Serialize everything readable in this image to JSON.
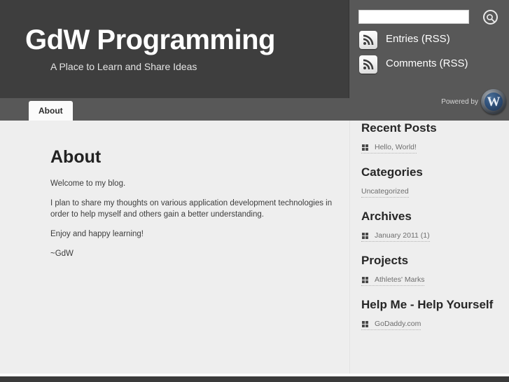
{
  "site": {
    "title": "GdW Programming",
    "tagline": "A Place to Learn and Share Ideas"
  },
  "search": {
    "value": "",
    "placeholder": "",
    "button_icon": "search-icon"
  },
  "feeds": [
    {
      "label": "Entries (RSS)",
      "icon": "rss-icon"
    },
    {
      "label": "Comments (RSS)",
      "icon": "rss-icon"
    }
  ],
  "powered_by": {
    "text": "Powered by",
    "logo_letter": "W",
    "logo_name": "wordpress-logo"
  },
  "nav": {
    "items": [
      {
        "label": "About",
        "active": true
      }
    ]
  },
  "main": {
    "title": "About",
    "paragraphs": [
      "Welcome to my blog.",
      "I plan to share my thoughts on various application development technologies in order to help myself and others gain a better understanding.",
      "Enjoy and happy learning!",
      "~GdW"
    ]
  },
  "sidebar": {
    "widgets": [
      {
        "title": "Recent Posts",
        "items": [
          {
            "label": "Hello, World!",
            "bullet": true
          }
        ]
      },
      {
        "title": "Categories",
        "items": [
          {
            "label": "Uncategorized",
            "bullet": false
          }
        ]
      },
      {
        "title": "Archives",
        "items": [
          {
            "label": "January 2011 (1)",
            "bullet": true
          }
        ]
      },
      {
        "title": "Projects",
        "items": [
          {
            "label": "Athletes' Marks",
            "bullet": true
          }
        ]
      },
      {
        "title": "Help Me - Help Yourself",
        "items": [
          {
            "label": "GoDaddy.com",
            "bullet": true
          }
        ]
      }
    ]
  },
  "colors": {
    "header_bg": "#3e3e3e",
    "nav_bg": "#585858",
    "content_bg": "#eeeeee",
    "footer_bg": "#3a3a3a",
    "link": "#6d6d6d"
  }
}
